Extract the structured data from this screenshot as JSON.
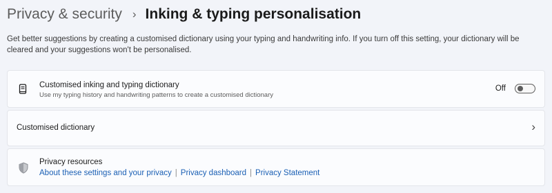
{
  "breadcrumb": {
    "parent": "Privacy & security",
    "separator": "›",
    "current": "Inking & typing personalisation"
  },
  "description": "Get better suggestions by creating a customised dictionary using your typing and handwriting info. If you turn off this setting, your dictionary will be cleared and your suggestions won't be personalised.",
  "dictionary_setting": {
    "icon": "notebook-icon",
    "title": "Customised inking and typing dictionary",
    "subtitle": "Use my typing history and handwriting patterns to create a customised dictionary",
    "toggle_label": "Off",
    "toggle_on": false
  },
  "custom_dictionary": {
    "title": "Customised dictionary",
    "chevron": "›"
  },
  "privacy_resources": {
    "icon": "shield-icon",
    "title": "Privacy resources",
    "links": [
      "About these settings and your privacy",
      "Privacy dashboard",
      "Privacy Statement"
    ],
    "link_separator": "|"
  },
  "colors": {
    "background": "#f2f4f9",
    "card": "#fbfcfe",
    "link": "#1a5fb4"
  }
}
